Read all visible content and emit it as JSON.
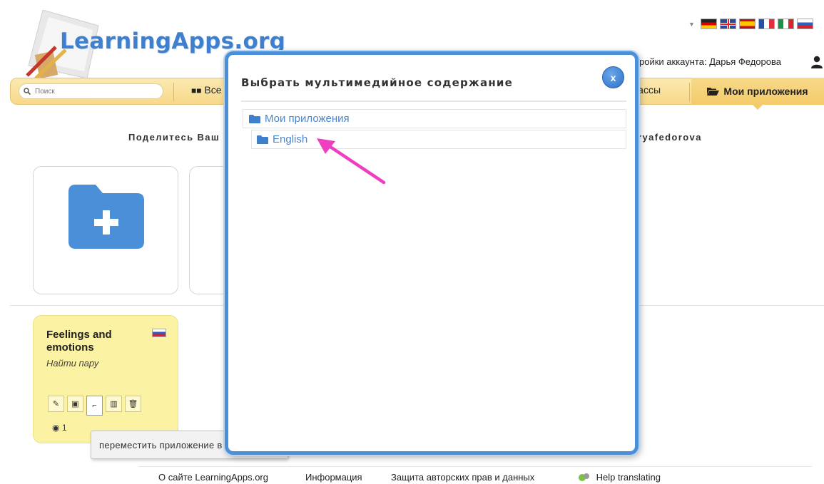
{
  "header": {
    "logo_text": "LearningApps.org",
    "account_text": "ройки аккаунта: Дарья Федорова",
    "flags": [
      "de",
      "gb",
      "es",
      "fr",
      "it",
      "ru"
    ]
  },
  "nav": {
    "search_placeholder": "Поиск",
    "all_label": "Все",
    "classes_label": "лассы",
    "my_apps_label": "Мои приложения"
  },
  "main": {
    "share_text": "Поделитесь Ваш",
    "share_right_text": "ryafedorova",
    "app_card": {
      "title": "Feelings and emotions",
      "type": "Найти пару",
      "views": "1",
      "tools": [
        "pencil-icon",
        "image-icon",
        "folder-move-icon",
        "stats-icon",
        "trash-icon"
      ]
    },
    "tooltip": "переместить приложение в папку"
  },
  "modal": {
    "title": "Выбрать мультимедийное содержание",
    "close_label": "x",
    "tree": {
      "root": "Мои приложения",
      "child": "English"
    }
  },
  "footer": {
    "about": "О сайте LearningApps.org",
    "info": "Информация",
    "copyright": "Защита авторских прав и данных",
    "help": "Help translating"
  },
  "colors": {
    "accent": "#4a8fd8",
    "navbar": "#f7d98a",
    "app_card": "#fbf2a4",
    "arrow": "#ee3fc0"
  }
}
